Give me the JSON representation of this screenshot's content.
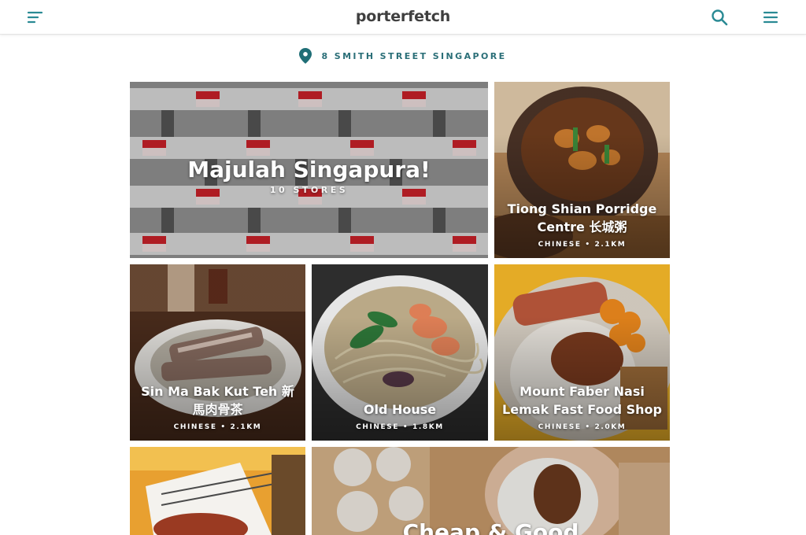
{
  "app": {
    "brand": "porterfetch"
  },
  "header": {
    "menu_icon": "sort-lines-icon",
    "search_icon": "search-icon",
    "hamburger_icon": "hamburger-icon"
  },
  "location": {
    "icon": "map-pin-icon",
    "address": "8 SMITH STREET SINGAPORE"
  },
  "colors": {
    "accent": "#2a8a94",
    "address": "#2b6f78",
    "brand": "#3f3f3f"
  },
  "collections": [
    {
      "title": "Majulah Singapura!",
      "subtitle": "10 STORES"
    },
    {
      "title": "Cheap & Good"
    }
  ],
  "restaurants": [
    {
      "name": "Tiong Shian Porridge Centre 长城粥",
      "meta": "CHINESE • 2.1KM"
    },
    {
      "name": "Sin Ma Bak Kut Teh 新馬肉骨茶",
      "meta": "CHINESE • 2.1KM"
    },
    {
      "name": "Old House",
      "meta": "CHINESE • 1.8KM"
    },
    {
      "name": "Mount Faber Nasi Lemak Fast Food Shop",
      "meta": "CHINESE • 2.0KM"
    },
    {
      "name": "",
      "meta": ""
    }
  ]
}
